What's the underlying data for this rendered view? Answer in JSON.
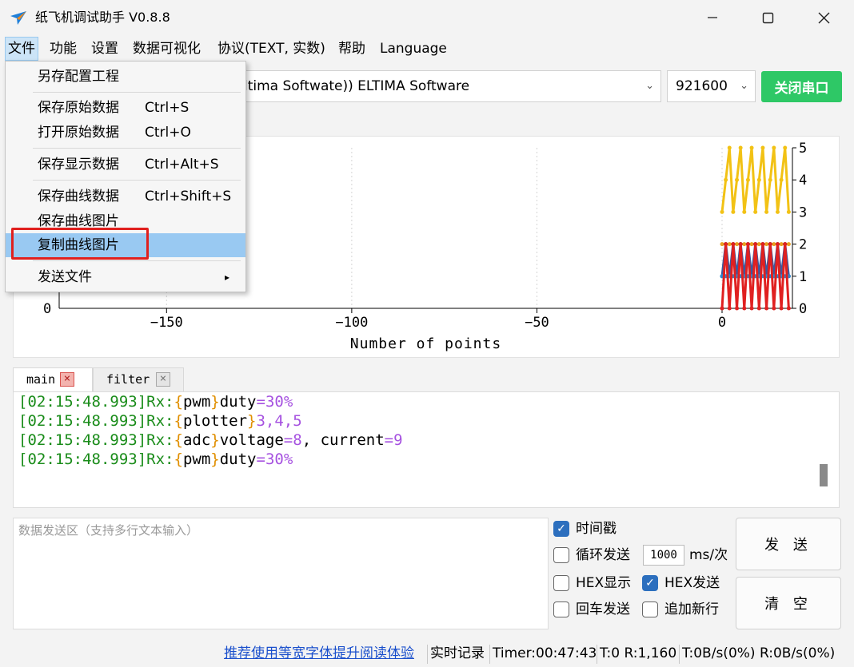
{
  "window": {
    "title": "纸飞机调试助手 V0.8.8",
    "minimize_icon": "minimize-icon",
    "maximize_icon": "maximize-icon",
    "close_icon": "close-icon"
  },
  "menu": {
    "items": [
      "文件",
      "功能",
      "设置",
      "数据可视化",
      "协议(TEXT, 实数)",
      "帮助",
      "Language"
    ]
  },
  "toolbar": {
    "port": "ltima Softwate)) ELTIMA Software",
    "baud": "921600",
    "close_port": "关闭串口"
  },
  "file_menu": {
    "items": [
      {
        "label": "另存配置工程",
        "shortcut": ""
      },
      {
        "label": "保存原始数据",
        "shortcut": "Ctrl+S"
      },
      {
        "label": "打开原始数据",
        "shortcut": "Ctrl+O"
      },
      {
        "label": "保存显示数据",
        "shortcut": "Ctrl+Alt+S"
      },
      {
        "label": "保存曲线数据",
        "shortcut": "Ctrl+Shift+S"
      },
      {
        "label": "保存曲线图片",
        "shortcut": ""
      },
      {
        "label": "复制曲线图片",
        "shortcut": ""
      },
      {
        "label": "发送文件",
        "shortcut": "▸"
      }
    ],
    "highlighted": "复制曲线图片"
  },
  "chart_data": {
    "type": "line",
    "xlabel": "Number of points",
    "ylabel": "",
    "x_ticks": [
      -150,
      -100,
      -50,
      0
    ],
    "y_ticks_right": [
      0,
      1,
      2,
      3,
      4,
      5
    ],
    "y_ticks_left_visible": [
      0
    ],
    "xlim": [
      -179,
      19
    ],
    "ylim": [
      0,
      5
    ],
    "grid": true,
    "series": [
      {
        "color": "#f2c215",
        "pattern": [
          3,
          4,
          5
        ],
        "x_start": 0,
        "x_end": 18
      },
      {
        "color": "#e8a020",
        "pattern": [
          2
        ],
        "x_start": 0,
        "x_end": 18
      },
      {
        "color": "#3a5aa0",
        "pattern": [
          1,
          2
        ],
        "x_start": 0,
        "x_end": 18
      },
      {
        "color": "#2a8ad0",
        "pattern": [
          1
        ],
        "x_start": 0,
        "x_end": 18
      },
      {
        "color": "#e02020",
        "pattern": [
          0,
          2
        ],
        "x_start": 0,
        "x_end": 18
      }
    ]
  },
  "tabs": [
    {
      "label": "main",
      "close_icon": "close-icon"
    },
    {
      "label": "filter",
      "close_icon": "close-icon"
    }
  ],
  "console": {
    "lines": [
      {
        "ts": "[02:15:48.993]",
        "rx": "Rx:",
        "ob": "{",
        "key": "pwm",
        "cb": "}",
        "rest": "duty",
        "eq": "=",
        "val": "30%"
      },
      {
        "ts": "[02:15:48.993]",
        "rx": "Rx:",
        "ob": "{",
        "key": "plotter",
        "cb": "}",
        "rest": "3,4,5"
      },
      {
        "ts": "[02:15:48.993]",
        "rx": "Rx:",
        "ob": "{",
        "key": "adc",
        "cb": "}",
        "rest": "voltage",
        "eq": "=",
        "val": "8",
        "rest2": ", current",
        "eq2": "=",
        "val2": "9"
      },
      {
        "ts": "[02:15:48.993]",
        "rx": "Rx:",
        "ob": "{",
        "key": "pwm",
        "cb": "}",
        "rest": "duty",
        "eq": "=",
        "val": "30%"
      }
    ]
  },
  "send": {
    "placeholder": "数据发送区（支持多行文本输入）",
    "timestamp_label": "时间戳",
    "timestamp_checked": true,
    "loop_label": "循环发送",
    "loop_checked": false,
    "interval": "1000",
    "interval_unit": "ms/次",
    "hex_display_label": "HEX显示",
    "hex_display_checked": false,
    "hex_send_label": "HEX发送",
    "hex_send_checked": true,
    "enter_send_label": "回车发送",
    "enter_send_checked": false,
    "newline_label": "追加新行",
    "newline_checked": false,
    "send_button": "发 送",
    "clear_button": "清 空"
  },
  "status": {
    "link": "推荐使用等宽字体提升阅读体验",
    "record": "实时记录",
    "timer": "Timer:00:47:43",
    "counts": "T:0 R:1,160",
    "rates": "T:0B/s(0%) R:0B/s(0%)"
  }
}
